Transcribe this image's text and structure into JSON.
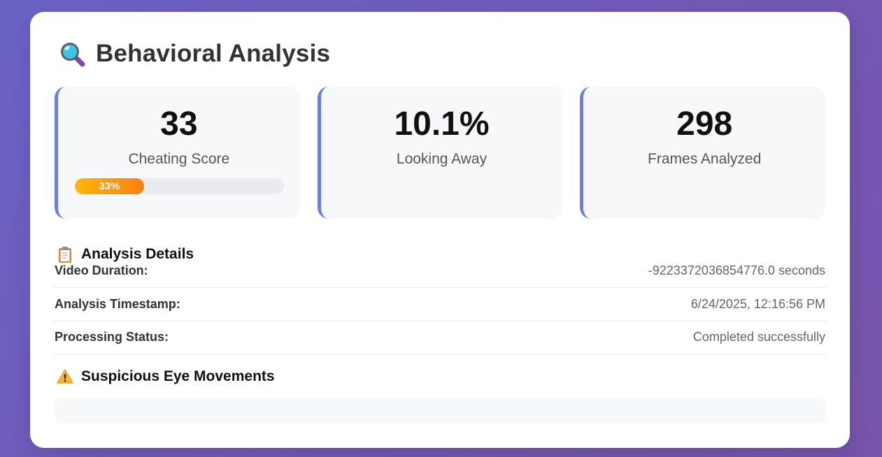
{
  "page": {
    "title": "Behavioral Analysis",
    "title_icon": "magnifying-glass-icon"
  },
  "stats": [
    {
      "value": "33",
      "label": "Cheating Score",
      "progress_percent": 33,
      "progress_label": "33%"
    },
    {
      "value": "10.1%",
      "label": "Looking Away"
    },
    {
      "value": "298",
      "label": "Frames Analyzed"
    }
  ],
  "analysis_details": {
    "title": "Analysis Details",
    "icon": "clipboard-icon",
    "rows": [
      {
        "key": "Video Duration:",
        "value": "-9223372036854776.0 seconds"
      },
      {
        "key": "Analysis Timestamp:",
        "value": "6/24/2025, 12:16:56 PM"
      },
      {
        "key": "Processing Status:",
        "value": "Completed successfully"
      }
    ]
  },
  "suspicious": {
    "title": "Suspicious Eye Movements",
    "icon": "warning-icon"
  },
  "colors": {
    "accent": "#6a7fe0",
    "progress_start": "#ffb70a",
    "progress_end": "#ff7e14",
    "background_start": "#6a63c6",
    "background_end": "#7753ac"
  }
}
